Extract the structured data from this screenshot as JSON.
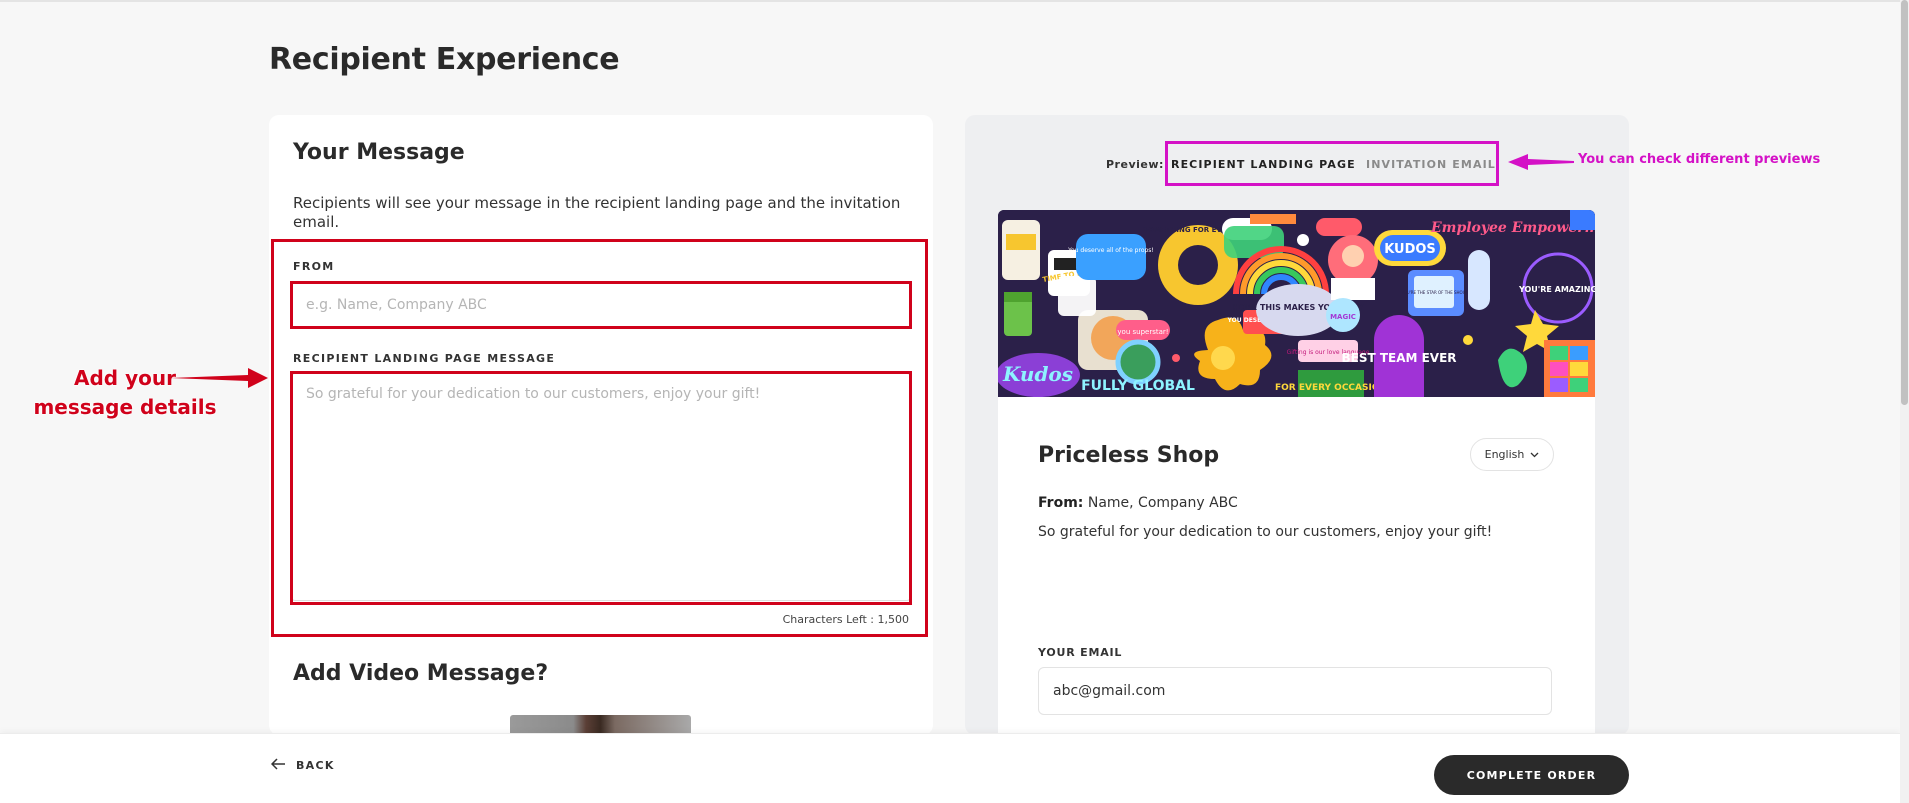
{
  "page": {
    "title": "Recipient Experience"
  },
  "message_card": {
    "title": "Your Message",
    "description": "Recipients will see your message in the recipient landing page and the invitation email.",
    "from_label": "FROM",
    "from_placeholder": "e.g. Name, Company ABC",
    "from_value": "",
    "message_label": "RECIPIENT LANDING PAGE MESSAGE",
    "message_placeholder": "So grateful for your dedication to our customers, enjoy your gift!",
    "message_value": "",
    "chars_left": "Characters Left : 1,500",
    "video_title": "Add Video Message?"
  },
  "preview": {
    "label": "Preview:",
    "tabs": [
      {
        "label": "RECIPIENT LANDING PAGE",
        "active": true
      },
      {
        "label": "INVITATION EMAIL",
        "active": false
      }
    ],
    "banner_stickers": [
      "KUDOS",
      "Employee Empowerment",
      "Kudos",
      "HOPE THIS MAKES YOUR DAY",
      "BEST TEAM EVER",
      "FULLY GLOBAL",
      "YOU'RE AMAZING",
      "TIME TO DIVE RIGHT IN",
      "SOMETHING FOR EVERYONE",
      "you superstar!",
      "YOU DESERVE A TREAT",
      "MAGIC",
      "FOR EVERY OCCASION",
      "YOU'RE THE STAR OF THE SHOW",
      "You deserve all of the props!",
      "Gifting is our love language"
    ],
    "landing": {
      "shop_name": "Priceless Shop",
      "language": "English",
      "from_prefix": "From:",
      "from_value": "Name, Company ABC",
      "message": "So grateful for your dedication to our customers, enjoy your gift!",
      "email_label": "YOUR EMAIL",
      "email_value": "abc@gmail.com"
    }
  },
  "annotations": {
    "left_text_line1": "Add your",
    "left_text_line2": "message details",
    "right_text": "You can check different previews",
    "red_color": "#d0021b",
    "pink_color": "#d411c6"
  },
  "footer": {
    "back_label": "BACK",
    "complete_label": "COMPLETE ORDER"
  }
}
